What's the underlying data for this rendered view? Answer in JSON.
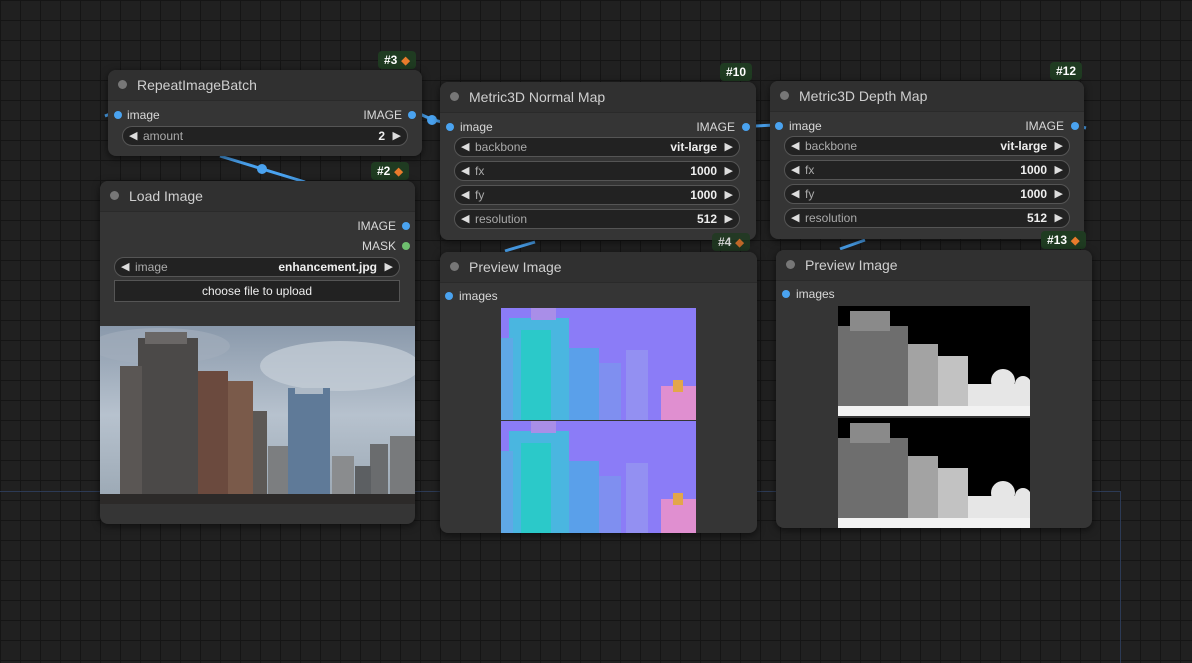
{
  "canvas": {
    "background": "#202020",
    "link_color": "#4aa3f0"
  },
  "nodes": {
    "repeat": {
      "badge": "#3",
      "title": "RepeatImageBatch",
      "input_label": "image",
      "output_label": "IMAGE",
      "widgets": [
        {
          "label": "amount",
          "value": "2"
        }
      ]
    },
    "load": {
      "badge": "#2",
      "title": "Load Image",
      "outputs": [
        "IMAGE",
        "MASK"
      ],
      "image_widget": {
        "label": "image",
        "value": "enhancement.jpg"
      },
      "upload_button": "choose file to upload"
    },
    "normal": {
      "badge": "#10",
      "title": "Metric3D Normal Map",
      "input_label": "image",
      "output_label": "IMAGE",
      "widgets": [
        {
          "label": "backbone",
          "value": "vit-large"
        },
        {
          "label": "fx",
          "value": "1000"
        },
        {
          "label": "fy",
          "value": "1000"
        },
        {
          "label": "resolution",
          "value": "512"
        }
      ]
    },
    "depth": {
      "badge": "#12",
      "title": "Metric3D Depth Map",
      "input_label": "image",
      "output_label": "IMAGE",
      "widgets": [
        {
          "label": "backbone",
          "value": "vit-large"
        },
        {
          "label": "fx",
          "value": "1000"
        },
        {
          "label": "fy",
          "value": "1000"
        },
        {
          "label": "resolution",
          "value": "512"
        }
      ]
    },
    "preview1": {
      "badge": "#4",
      "title": "Preview Image",
      "input_label": "images"
    },
    "preview2": {
      "badge": "#13",
      "title": "Preview Image",
      "input_label": "images"
    }
  },
  "icons": {
    "badge_icon": "fox-icon",
    "arrow_left": "arrow-left-icon",
    "arrow_right": "arrow-right-icon"
  },
  "colors": {
    "badge_bg": "#1f3b21",
    "node_bg": "#353535",
    "slot_image": "#4aa3f0",
    "slot_mask": "#6fc06f",
    "normal_map": "#8b7cf7",
    "normal_cyan": "#2bc9c9"
  }
}
